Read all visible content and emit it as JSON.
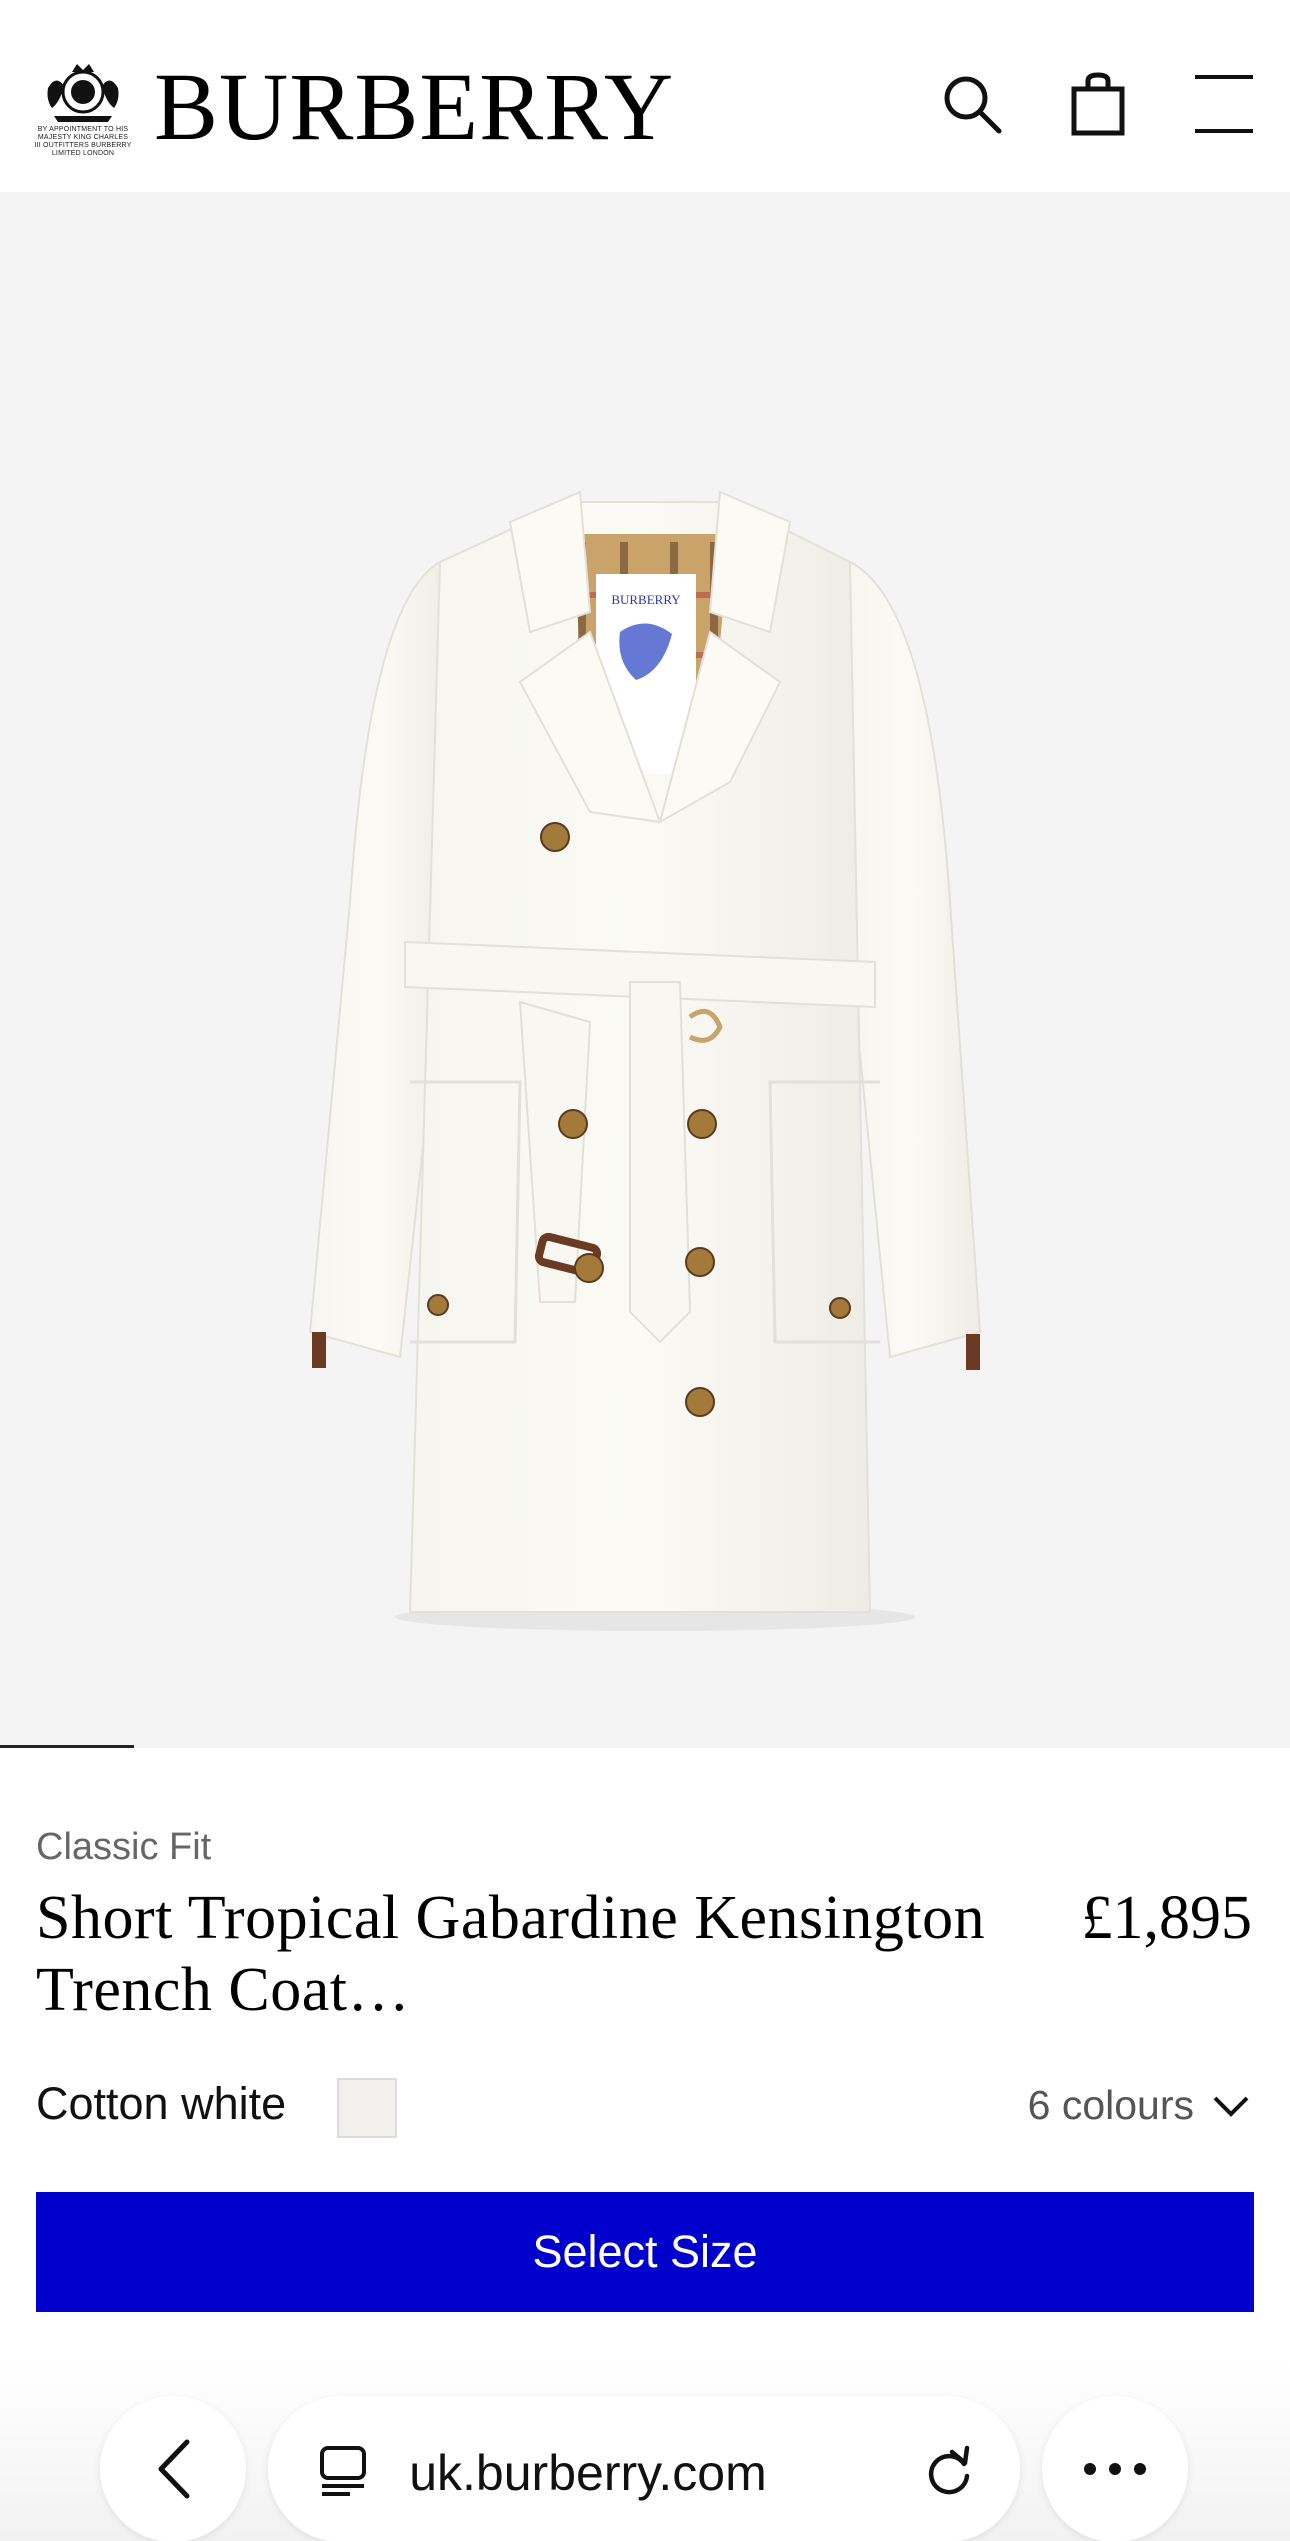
{
  "header": {
    "crest_text": "BY APPOINTMENT TO HIS MAJESTY KING CHARLES III OUTFITTERS BURBERRY LIMITED LONDON",
    "brand": "BURBERRY",
    "icons": [
      "royal-crest-icon",
      "search-icon",
      "shopping-bag-icon",
      "menu-icon"
    ]
  },
  "gallery": {
    "image_label": "BURBERRY",
    "progress": 0.104
  },
  "product": {
    "fit": "Classic Fit",
    "title": "Short Tropical Gabardine Kensington Trench Coat…",
    "price": "£1,895",
    "colour_name": "Cotton white",
    "swatch_color": "#f1f0ed",
    "colour_count": "6 colours",
    "select_size_label": "Select Size"
  },
  "browser": {
    "url": "uk.burberry.com",
    "icons": [
      "back-icon",
      "tabs-icon",
      "reload-icon",
      "more-icon"
    ]
  },
  "colors": {
    "accent": "#0000cc",
    "hero_bg": "#f4f4f4"
  }
}
